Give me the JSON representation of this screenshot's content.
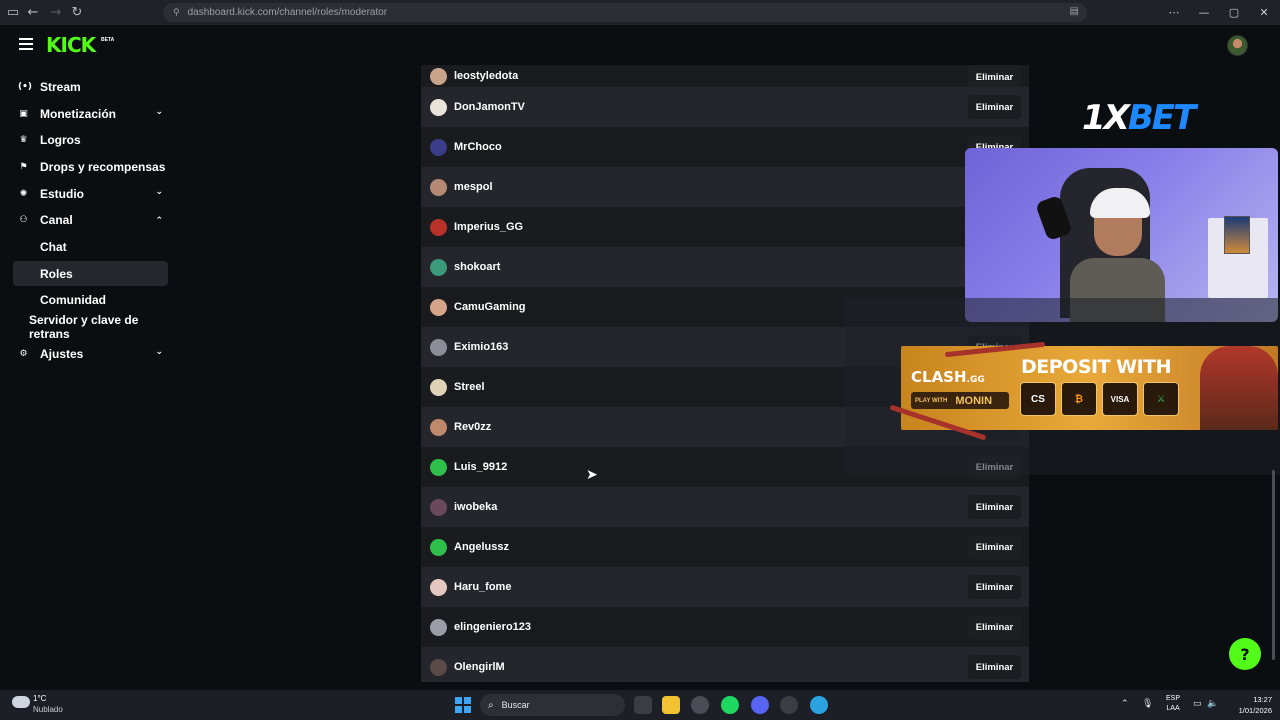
{
  "browser": {
    "url": "dashboard.kick.com/channel/roles/moderator",
    "back": "←",
    "forward": "→",
    "reload": "↻",
    "more": "⋯",
    "minimize": "—",
    "maximize": "▢",
    "close": "✕"
  },
  "header": {
    "logo": "KICK",
    "logo_badge": "BETA"
  },
  "sidebar": {
    "items": [
      {
        "label": "Stream",
        "icon": "broadcast-icon",
        "glyph": "(•)",
        "chevron": ""
      },
      {
        "label": "Monetización",
        "icon": "chart-icon",
        "glyph": "▣",
        "chevron": "⌄"
      },
      {
        "label": "Logros",
        "icon": "trophy-icon",
        "glyph": "♛",
        "chevron": ""
      },
      {
        "label": "Drops y recompensas",
        "icon": "drops-icon",
        "glyph": "⚑",
        "chevron": ""
      },
      {
        "label": "Estudio",
        "icon": "studio-icon",
        "glyph": "✺",
        "chevron": "⌄"
      },
      {
        "label": "Canal",
        "icon": "channel-icon",
        "glyph": "⚇",
        "chevron": "⌃"
      },
      {
        "label": "Chat",
        "sub": true
      },
      {
        "label": "Roles",
        "sub": true,
        "active": true
      },
      {
        "label": "Comunidad",
        "sub": true
      },
      {
        "label": "Servidor y clave de retrans",
        "sub2": true
      },
      {
        "label": "Ajustes",
        "icon": "gear-icon",
        "glyph": "⚙",
        "chevron": "⌄"
      }
    ]
  },
  "moderators": {
    "remove_label": "Eliminar",
    "rows": [
      {
        "name": "leostyledota",
        "color": "#c9a48a"
      },
      {
        "name": "DonJamonTV",
        "color": "#e8e4dc"
      },
      {
        "name": "MrChoco",
        "color": "#3b3d8a"
      },
      {
        "name": "mespol",
        "color": "#b58a74"
      },
      {
        "name": "Imperius_GG",
        "color": "#b8322a"
      },
      {
        "name": "shokoart",
        "color": "#3a9a7a"
      },
      {
        "name": "CamuGaming",
        "color": "#d4a58a"
      },
      {
        "name": "Eximio163",
        "color": "#8a8e96"
      },
      {
        "name": "Streel",
        "color": "#e0d2b8"
      },
      {
        "name": "Rev0zz",
        "color": "#c08a6a"
      },
      {
        "name": "Luis_9912",
        "color": "#2fbf4a"
      },
      {
        "name": "iwobeka",
        "color": "#6a4a5a"
      },
      {
        "name": "Angelussz",
        "color": "#2fbf4a"
      },
      {
        "name": "Haru_fome",
        "color": "#e4c8c0"
      },
      {
        "name": "elingeniero123",
        "color": "#9a9ea6"
      },
      {
        "name": "OlengirlM",
        "color": "#5a4a4a"
      }
    ]
  },
  "overlay": {
    "sponsor_1x": "1X",
    "sponsor_bet": "BET",
    "banner_brand": "CLASH",
    "banner_brand_tld": ".GG",
    "banner_pay_prefix": "PLAY WITH",
    "banner_pay_name": "MONIN",
    "banner_title": "DEPOSIT WITH",
    "banner_methods": [
      "CS",
      "₿",
      "VISA",
      "⚔"
    ]
  },
  "help_button": "?",
  "taskbar": {
    "temperature": "1°C",
    "weather": "Nublado",
    "search_placeholder": "Buscar",
    "search_glyph": "⌕",
    "lang_line1": "ESP",
    "lang_line2": "LAA",
    "time": "13:27",
    "date": "1/01/2026",
    "tray_up": "⌃",
    "tray_mic": "🎙",
    "tray_net": "▭",
    "tray_vol": "🔈",
    "tray_bell": "🔔"
  }
}
